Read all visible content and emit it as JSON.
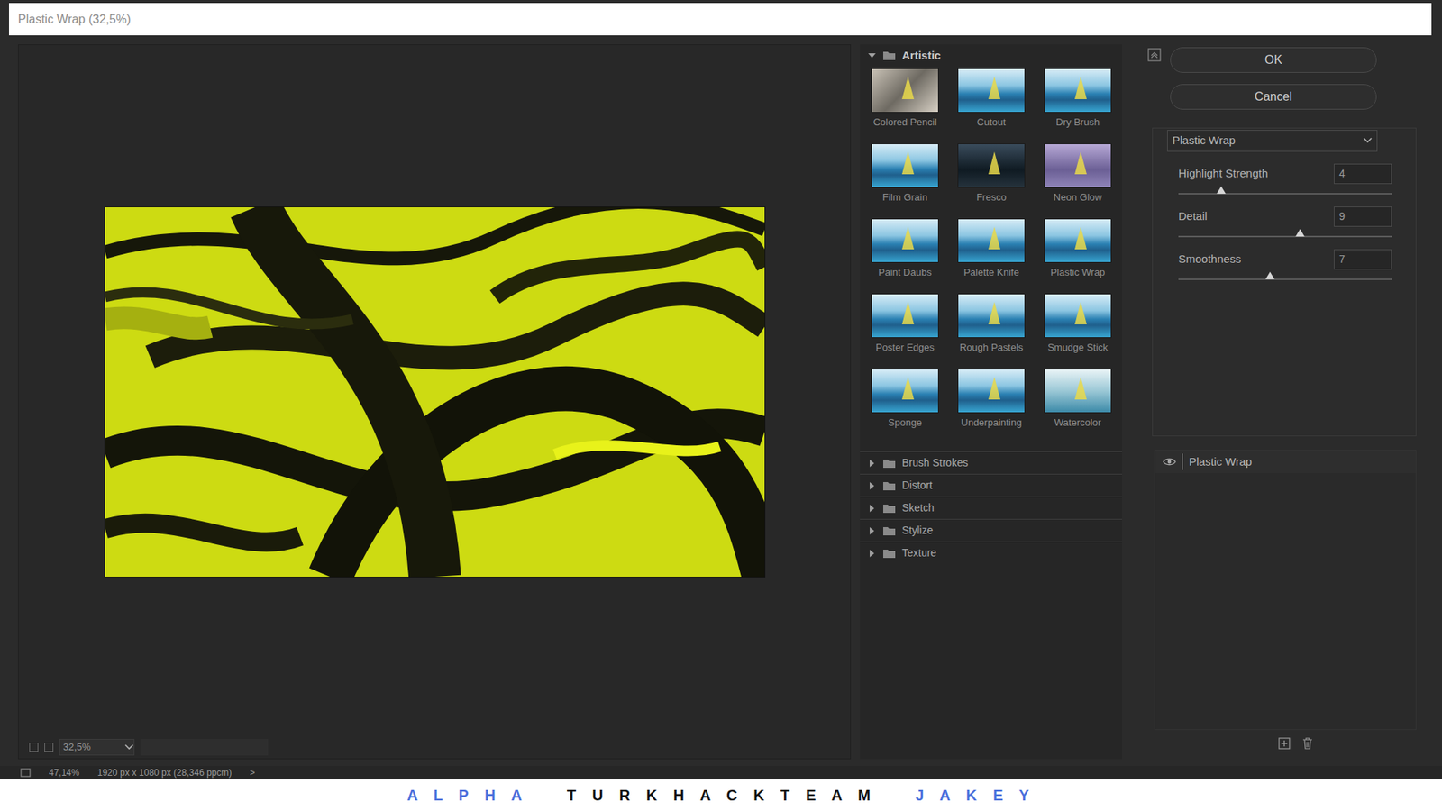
{
  "window": {
    "title": "Plastic Wrap (32,5%)"
  },
  "preview": {
    "zoom": "32,5%"
  },
  "gallery": {
    "categories": [
      {
        "name": "Artistic",
        "expanded": true,
        "filters": [
          {
            "name": "Colored Pencil"
          },
          {
            "name": "Cutout"
          },
          {
            "name": "Dry Brush"
          },
          {
            "name": "Film Grain"
          },
          {
            "name": "Fresco"
          },
          {
            "name": "Neon Glow"
          },
          {
            "name": "Paint Daubs"
          },
          {
            "name": "Palette Knife"
          },
          {
            "name": "Plastic Wrap"
          },
          {
            "name": "Poster Edges"
          },
          {
            "name": "Rough Pastels"
          },
          {
            "name": "Smudge Stick"
          },
          {
            "name": "Sponge"
          },
          {
            "name": "Underpainting"
          },
          {
            "name": "Watercolor"
          }
        ]
      },
      {
        "name": "Brush Strokes",
        "expanded": false
      },
      {
        "name": "Distort",
        "expanded": false
      },
      {
        "name": "Sketch",
        "expanded": false
      },
      {
        "name": "Stylize",
        "expanded": false
      },
      {
        "name": "Texture",
        "expanded": false
      }
    ]
  },
  "buttons": [
    {
      "label": "OK"
    },
    {
      "label": "Cancel"
    }
  ],
  "settings": {
    "filter": "Plastic Wrap",
    "params": [
      {
        "label": "Highlight Strength",
        "value": "4",
        "level": 0.2
      },
      {
        "label": "Detail",
        "value": "9",
        "level": 0.57
      },
      {
        "label": "Smoothness",
        "value": "7",
        "level": 0.43
      }
    ]
  },
  "effect_layers": [
    {
      "name": "Plastic Wrap",
      "visible": true
    }
  ],
  "status_bar": {
    "zoom": "47,14%",
    "doc_info": "1920 px x 1080 px (28,346 ppcm)",
    "arrow": ">"
  },
  "watermark": [
    {
      "text": "A L P H A",
      "color": "#4a6fdc"
    },
    {
      "text": "T U R K H A C K T E A M",
      "color": "#111111"
    },
    {
      "text": "J A K E Y",
      "color": "#4a6fdc"
    }
  ]
}
